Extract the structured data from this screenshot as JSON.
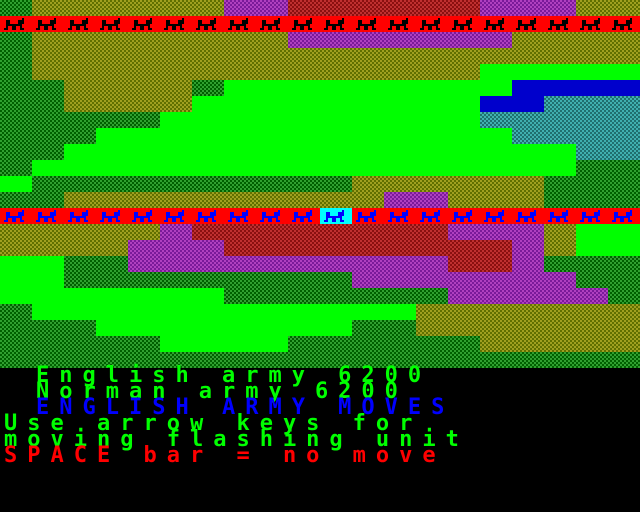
{
  "colors": {
    "background": "#000000",
    "grass": "#00ff00",
    "army_row": "#ff0000",
    "english_unit": "#0000ff",
    "norman_unit": "#ff0000",
    "selected_unit_bg": "#00ffff",
    "magenta_terrain": "#ff00ff",
    "olive_terrain": "#808000",
    "water": "#0000ff"
  },
  "units": {
    "norman_icon": "horseman-icon",
    "english_icon": "soldier-icon",
    "norman_count": 20,
    "english_count": 20,
    "selected_index": 10
  },
  "status": {
    "english_army": "English army 6200",
    "norman_army": "Norman army 6200",
    "turn": "ENGLISH ARMY MOVES",
    "instruction_1": "Use arrow keys for",
    "instruction_2": "moving flashing unit",
    "space_hint": "SPACE bar = no move"
  }
}
